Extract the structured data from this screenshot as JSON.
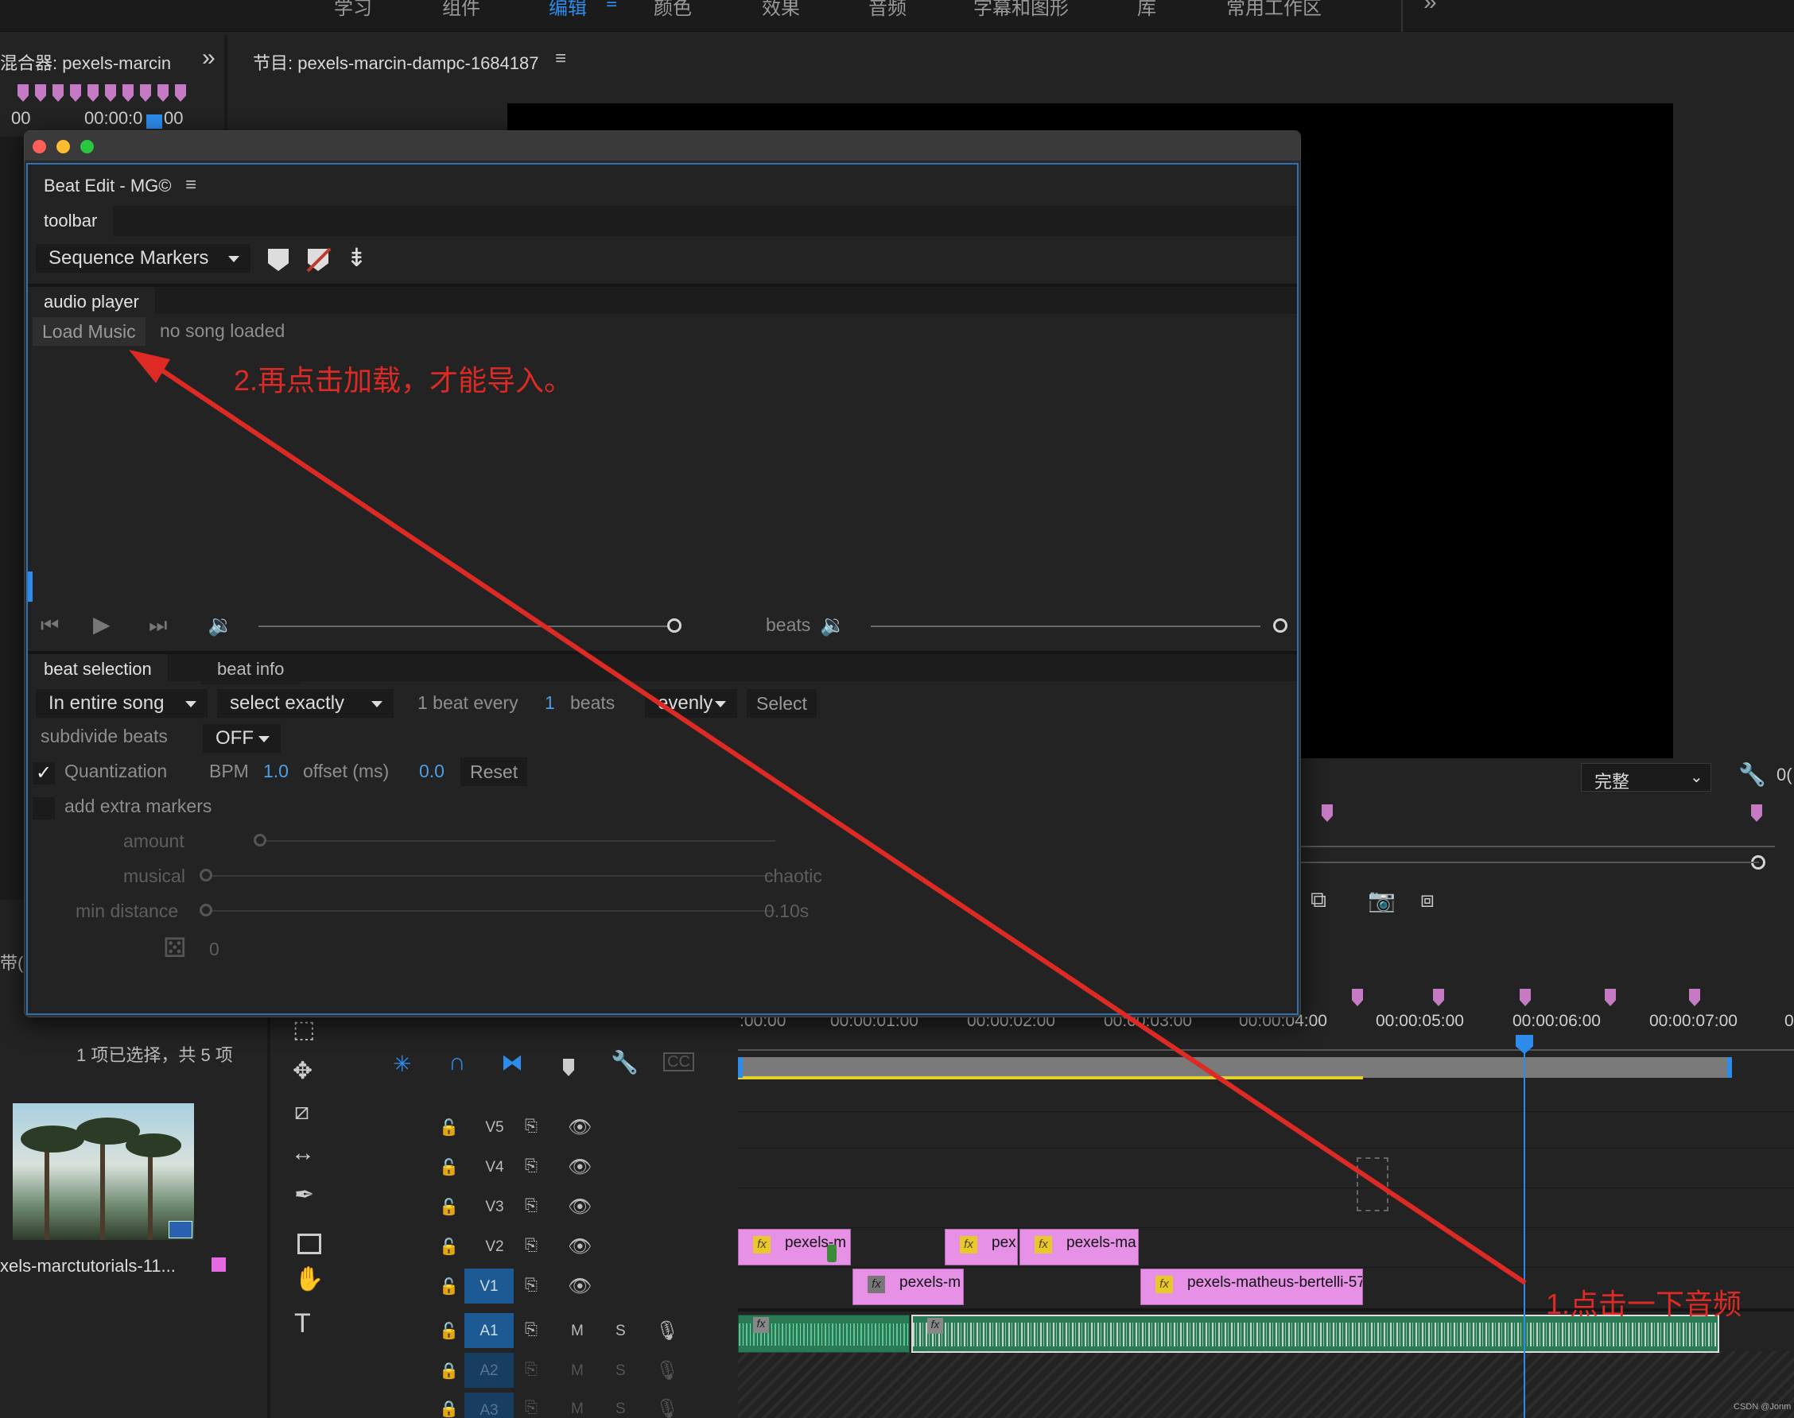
{
  "workspace_tabs": [
    "学习",
    "组件",
    "编辑",
    "颜色",
    "效果",
    "音频",
    "字幕和图形",
    "库",
    "常用工作区"
  ],
  "workspace_active": "编辑",
  "more_glyph": "»",
  "audio_mixer": {
    "title": "混合器: pexels-marcin",
    "time_left": "00",
    "time": "00:00:0",
    "time_tail": "00"
  },
  "program_monitor": {
    "title": "节目: pexels-marcin-dampc-1684187",
    "quality": "完整",
    "right_edge": "0("
  },
  "project": {
    "selection_text": "1 项已选择，共 5 项",
    "clip_name": "xels-marctutorials-11...",
    "side_text": "带("
  },
  "plugin": {
    "window_title": "Beat Edit - MG©",
    "toolbar_tab": "toolbar",
    "marker_mode": "Sequence Markers",
    "audio_player_tab": "audio player",
    "load_music": "Load Music",
    "song_status": "no song loaded",
    "beats_label": "beats",
    "tabs": {
      "beat_selection": "beat selection",
      "beat_info": "beat info"
    },
    "scope": "In entire song",
    "select_mode": "select exactly",
    "beat_every_prefix": "1 beat every",
    "beat_every_value": "1",
    "beat_every_suffix": "beats",
    "distribution": "evenly",
    "select_button": "Select",
    "subdivide_label": "subdivide beats",
    "subdivide_value": "OFF",
    "quantization_label": "Quantization",
    "quantization_checked": true,
    "bpm_label": "BPM",
    "bpm_value": "1.0",
    "offset_label": "offset (ms)",
    "offset_value": "0.0",
    "reset_button": "Reset",
    "extra_markers_label": "add extra markers",
    "extra_markers_checked": false,
    "amount_label": "amount",
    "musical_label": "musical",
    "chaotic_label": "chaotic",
    "min_distance_label": "min distance",
    "min_distance_value": "0.10s",
    "seed_value": "0"
  },
  "timeline": {
    "ruler_labels": [
      ":00:00",
      "00:00:01:00",
      "00:00:02:00",
      "00:00:03:00",
      "00:00:04:00",
      "00:00:05:00",
      "00:00:06:00",
      "00:00:07:00",
      "0"
    ],
    "tracks": [
      {
        "name": "V5",
        "type": "video",
        "active": false
      },
      {
        "name": "V4",
        "type": "video",
        "active": false
      },
      {
        "name": "V3",
        "type": "video",
        "active": false
      },
      {
        "name": "V2",
        "type": "video",
        "active": false
      },
      {
        "name": "V1",
        "type": "video",
        "active": true
      },
      {
        "name": "A1",
        "type": "audio",
        "active": true
      },
      {
        "name": "A2",
        "type": "audio",
        "active": false
      },
      {
        "name": "A3",
        "type": "audio",
        "active": false
      }
    ],
    "mute_label": "M",
    "solo_label": "S",
    "v2_clips": [
      "pexels-m",
      "pex",
      "pexels-ma"
    ],
    "v1_clips": [
      "pexels-m",
      "pexels-matheus-bertelli-57"
    ],
    "fx_label": "fx"
  },
  "annotations": {
    "step1": "1.点击一下音频",
    "step2": "2.再点击加载，才能导入。",
    "arrow_color": "#dd2a24"
  },
  "watermark": "CSDN @Jonm"
}
